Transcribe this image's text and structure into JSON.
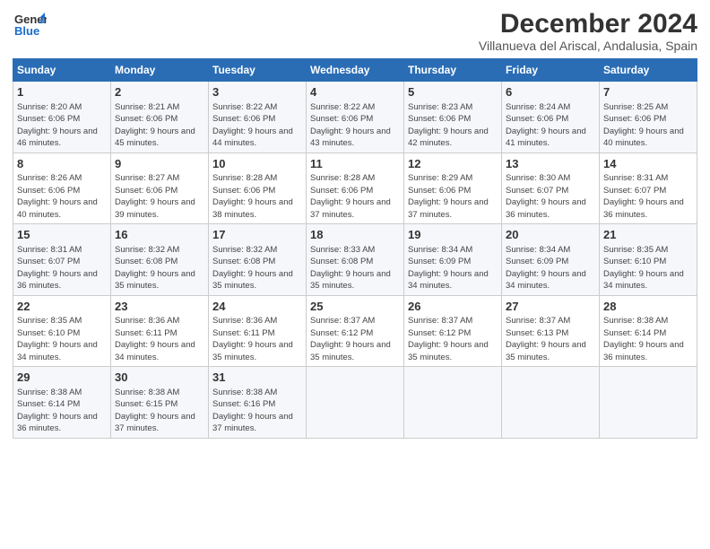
{
  "logo": {
    "general": "General",
    "blue": "Blue"
  },
  "header": {
    "title": "December 2024",
    "subtitle": "Villanueva del Ariscal, Andalusia, Spain"
  },
  "weekdays": [
    "Sunday",
    "Monday",
    "Tuesday",
    "Wednesday",
    "Thursday",
    "Friday",
    "Saturday"
  ],
  "weeks": [
    [
      {
        "day": "1",
        "sunrise": "8:20 AM",
        "sunset": "6:06 PM",
        "daylight": "9 hours and 46 minutes."
      },
      {
        "day": "2",
        "sunrise": "8:21 AM",
        "sunset": "6:06 PM",
        "daylight": "9 hours and 45 minutes."
      },
      {
        "day": "3",
        "sunrise": "8:22 AM",
        "sunset": "6:06 PM",
        "daylight": "9 hours and 44 minutes."
      },
      {
        "day": "4",
        "sunrise": "8:22 AM",
        "sunset": "6:06 PM",
        "daylight": "9 hours and 43 minutes."
      },
      {
        "day": "5",
        "sunrise": "8:23 AM",
        "sunset": "6:06 PM",
        "daylight": "9 hours and 42 minutes."
      },
      {
        "day": "6",
        "sunrise": "8:24 AM",
        "sunset": "6:06 PM",
        "daylight": "9 hours and 41 minutes."
      },
      {
        "day": "7",
        "sunrise": "8:25 AM",
        "sunset": "6:06 PM",
        "daylight": "9 hours and 40 minutes."
      }
    ],
    [
      {
        "day": "8",
        "sunrise": "8:26 AM",
        "sunset": "6:06 PM",
        "daylight": "9 hours and 40 minutes."
      },
      {
        "day": "9",
        "sunrise": "8:27 AM",
        "sunset": "6:06 PM",
        "daylight": "9 hours and 39 minutes."
      },
      {
        "day": "10",
        "sunrise": "8:28 AM",
        "sunset": "6:06 PM",
        "daylight": "9 hours and 38 minutes."
      },
      {
        "day": "11",
        "sunrise": "8:28 AM",
        "sunset": "6:06 PM",
        "daylight": "9 hours and 37 minutes."
      },
      {
        "day": "12",
        "sunrise": "8:29 AM",
        "sunset": "6:06 PM",
        "daylight": "9 hours and 37 minutes."
      },
      {
        "day": "13",
        "sunrise": "8:30 AM",
        "sunset": "6:07 PM",
        "daylight": "9 hours and 36 minutes."
      },
      {
        "day": "14",
        "sunrise": "8:31 AM",
        "sunset": "6:07 PM",
        "daylight": "9 hours and 36 minutes."
      }
    ],
    [
      {
        "day": "15",
        "sunrise": "8:31 AM",
        "sunset": "6:07 PM",
        "daylight": "9 hours and 36 minutes."
      },
      {
        "day": "16",
        "sunrise": "8:32 AM",
        "sunset": "6:08 PM",
        "daylight": "9 hours and 35 minutes."
      },
      {
        "day": "17",
        "sunrise": "8:32 AM",
        "sunset": "6:08 PM",
        "daylight": "9 hours and 35 minutes."
      },
      {
        "day": "18",
        "sunrise": "8:33 AM",
        "sunset": "6:08 PM",
        "daylight": "9 hours and 35 minutes."
      },
      {
        "day": "19",
        "sunrise": "8:34 AM",
        "sunset": "6:09 PM",
        "daylight": "9 hours and 34 minutes."
      },
      {
        "day": "20",
        "sunrise": "8:34 AM",
        "sunset": "6:09 PM",
        "daylight": "9 hours and 34 minutes."
      },
      {
        "day": "21",
        "sunrise": "8:35 AM",
        "sunset": "6:10 PM",
        "daylight": "9 hours and 34 minutes."
      }
    ],
    [
      {
        "day": "22",
        "sunrise": "8:35 AM",
        "sunset": "6:10 PM",
        "daylight": "9 hours and 34 minutes."
      },
      {
        "day": "23",
        "sunrise": "8:36 AM",
        "sunset": "6:11 PM",
        "daylight": "9 hours and 34 minutes."
      },
      {
        "day": "24",
        "sunrise": "8:36 AM",
        "sunset": "6:11 PM",
        "daylight": "9 hours and 35 minutes."
      },
      {
        "day": "25",
        "sunrise": "8:37 AM",
        "sunset": "6:12 PM",
        "daylight": "9 hours and 35 minutes."
      },
      {
        "day": "26",
        "sunrise": "8:37 AM",
        "sunset": "6:12 PM",
        "daylight": "9 hours and 35 minutes."
      },
      {
        "day": "27",
        "sunrise": "8:37 AM",
        "sunset": "6:13 PM",
        "daylight": "9 hours and 35 minutes."
      },
      {
        "day": "28",
        "sunrise": "8:38 AM",
        "sunset": "6:14 PM",
        "daylight": "9 hours and 36 minutes."
      }
    ],
    [
      {
        "day": "29",
        "sunrise": "8:38 AM",
        "sunset": "6:14 PM",
        "daylight": "9 hours and 36 minutes."
      },
      {
        "day": "30",
        "sunrise": "8:38 AM",
        "sunset": "6:15 PM",
        "daylight": "9 hours and 37 minutes."
      },
      {
        "day": "31",
        "sunrise": "8:38 AM",
        "sunset": "6:16 PM",
        "daylight": "9 hours and 37 minutes."
      },
      null,
      null,
      null,
      null
    ]
  ]
}
